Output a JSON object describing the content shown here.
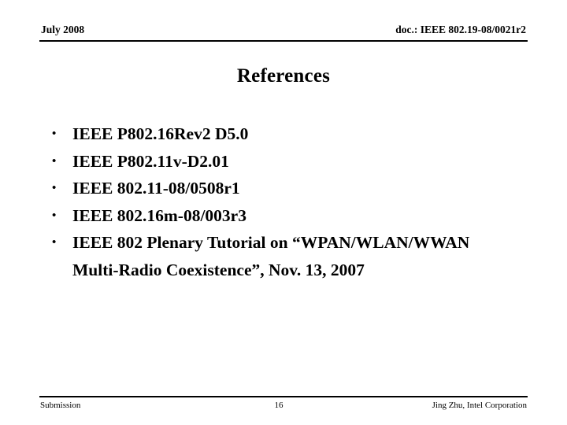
{
  "header": {
    "date": "July 2008",
    "doc_number": "doc.: IEEE 802.19-08/0021r2"
  },
  "title": "References",
  "bullets": [
    {
      "marker": "•",
      "text": "IEEE P802.16Rev2 D5.0"
    },
    {
      "marker": "•",
      "text": "IEEE P802.11v-D2.01"
    },
    {
      "marker": "•",
      "text": "IEEE 802.11-08/0508r1"
    },
    {
      "marker": "•",
      "text": "IEEE 802.16m-08/003r3"
    },
    {
      "marker": "•",
      "text": "IEEE 802 Plenary Tutorial on “WPAN/WLAN/WWAN\nMulti-Radio Coexistence”, Nov. 13, 2007"
    }
  ],
  "footer": {
    "left": "Submission",
    "page": "16",
    "right": "Jing Zhu, Intel Corporation"
  },
  "colors": {
    "text": "#000000",
    "background": "#ffffff",
    "rule": "#000000"
  }
}
